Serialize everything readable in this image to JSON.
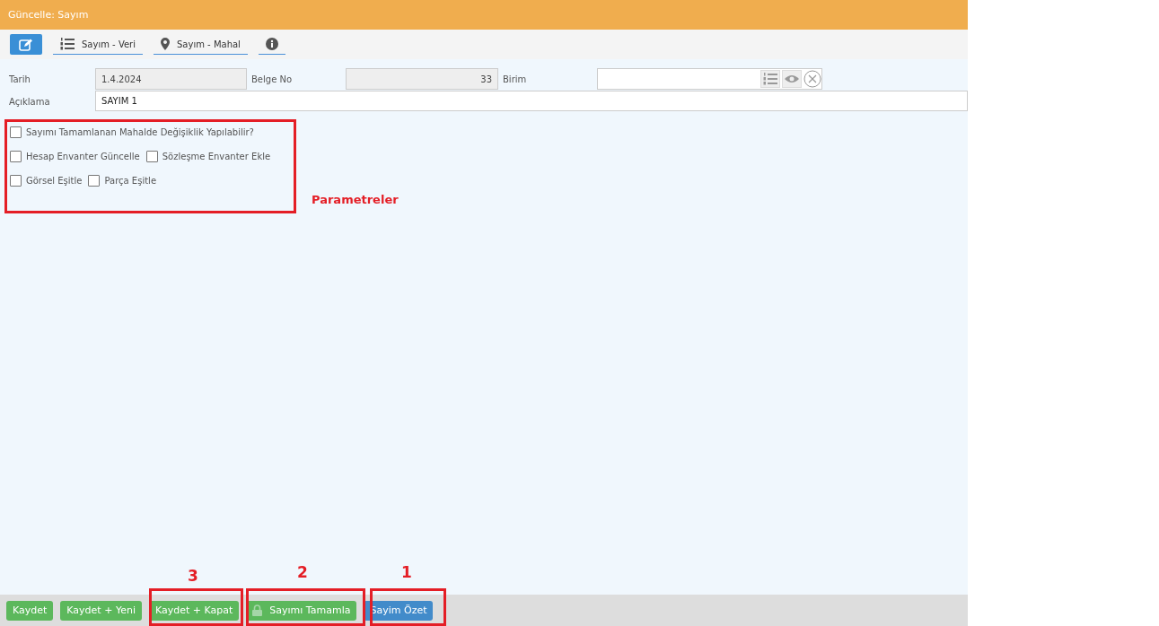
{
  "window": {
    "title": "Güncelle: Sayım"
  },
  "toolbar": [
    {
      "kind": "edit",
      "selected": true
    },
    {
      "kind": "list",
      "label": "Sayım - Veri",
      "selected": false
    },
    {
      "kind": "pin",
      "label": "Sayım - Mahal",
      "selected": false
    },
    {
      "kind": "info",
      "selected": false
    }
  ],
  "form": {
    "tarih": {
      "label": "Tarih",
      "value": "1.4.2024"
    },
    "belge_no": {
      "label": "Belge No",
      "value": "33"
    },
    "birim": {
      "label": "Birim"
    },
    "aciklama": {
      "label": "Açıklama",
      "value": "SAYIM 1"
    }
  },
  "parameters": [
    [
      {
        "label": "Sayımı Tamamlanan Mahalde Değişiklik Yapılabilir?",
        "checked": false
      }
    ],
    [
      {
        "label": "Hesap Envanter Güncelle",
        "checked": false
      },
      {
        "label": "Sözleşme Envanter Ekle",
        "checked": false
      }
    ],
    [
      {
        "label": "Görsel Eşitle",
        "checked": false
      },
      {
        "label": "Parça Eşitle",
        "checked": false
      }
    ]
  ],
  "footer_buttons": [
    {
      "label": "Kaydet",
      "kind": "success"
    },
    {
      "label": "Kaydet + Yeni",
      "kind": "success"
    },
    {
      "label": "Kaydet + Kapat",
      "kind": "success"
    },
    {
      "label": "Sayımı Tamamla",
      "kind": "success"
    },
    {
      "label": "Sayim Özet",
      "kind": "primary"
    }
  ],
  "annotations": [
    {
      "label": "Parametreler"
    },
    {
      "label": "3"
    },
    {
      "label": "2"
    },
    {
      "label": "1"
    }
  ]
}
